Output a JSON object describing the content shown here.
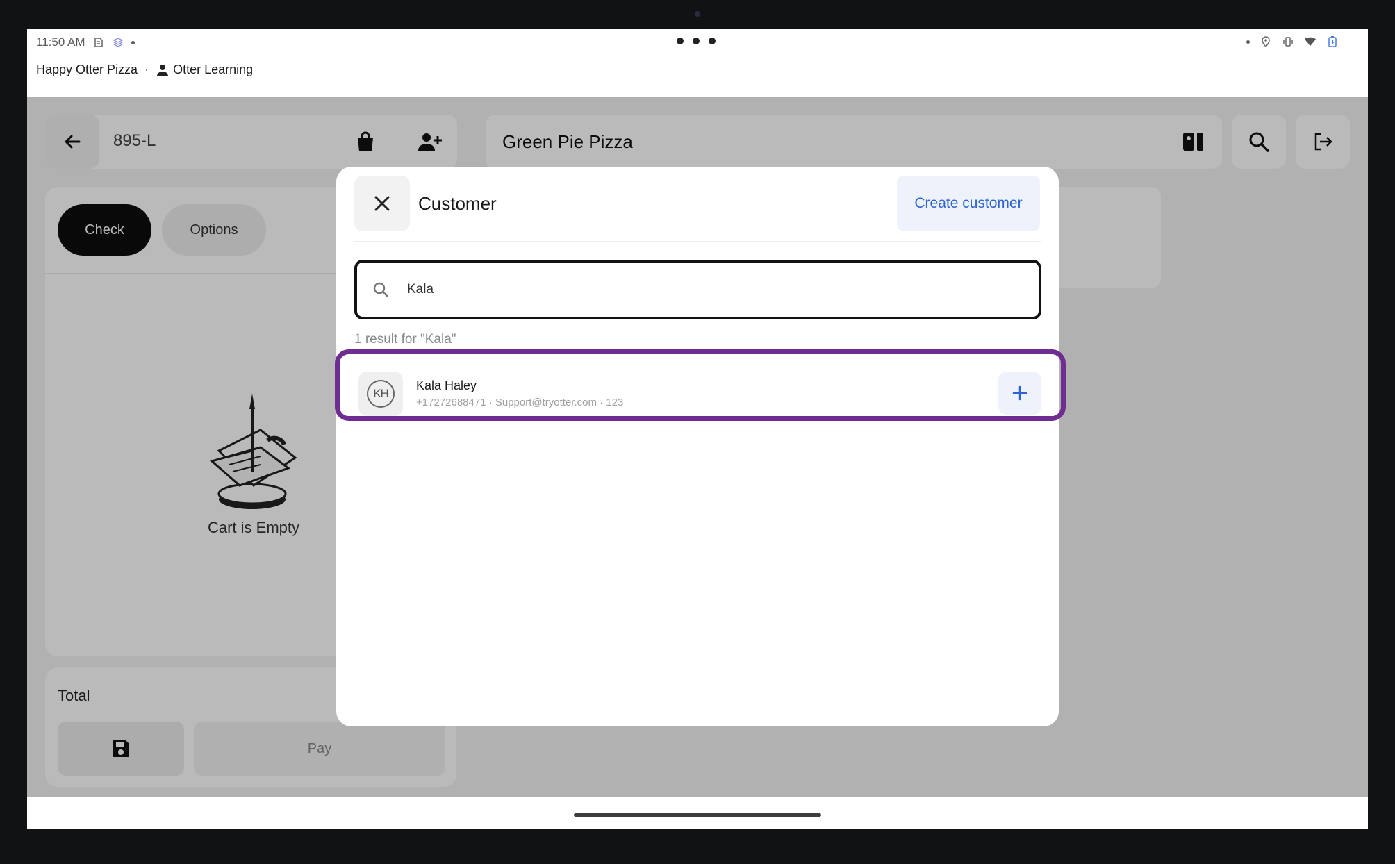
{
  "status_bar": {
    "time": "11:50 AM"
  },
  "account": {
    "store": "Happy Otter Pizza",
    "separator": "·",
    "user": "Otter Learning"
  },
  "order": {
    "id": "895-L"
  },
  "store_header": {
    "name": "Green Pie Pizza"
  },
  "cart": {
    "tab_check": "Check",
    "tab_options": "Options",
    "empty_text": "Cart is Empty"
  },
  "totals": {
    "label": "Total",
    "pay_label": "Pay"
  },
  "modal": {
    "title": "Customer",
    "create_label": "Create customer",
    "search_value": "Kala",
    "result_count": "1 result for \"Kala\"",
    "results": [
      {
        "initials": "KH",
        "name": "Kala Haley",
        "detail": "+17272688471 · Support@tryotter.com · 123"
      }
    ]
  },
  "colors": {
    "highlight": "#6f2c91",
    "accent": "#2e64d1",
    "primary_button": "#0d0d0d"
  },
  "icons": [
    "back-arrow-icon",
    "shopping-bag-icon",
    "add-person-icon",
    "menu-book-icon",
    "search-icon",
    "logout-icon",
    "close-icon",
    "floppy-disk-icon",
    "plus-icon",
    "user-icon"
  ]
}
